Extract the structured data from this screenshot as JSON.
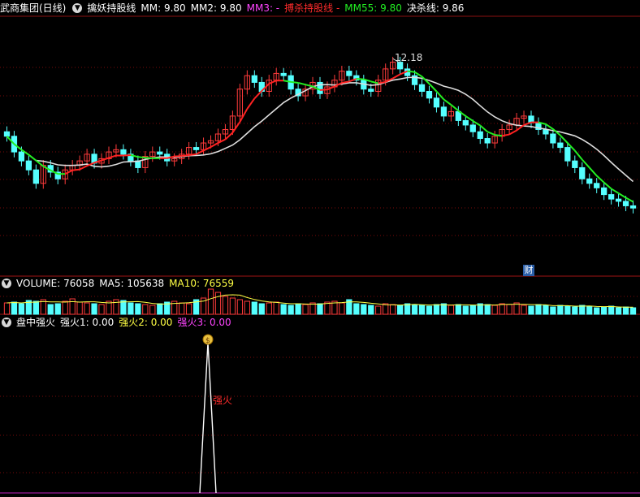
{
  "header": {
    "title": "武商集团(日线)",
    "indicator_name": "擒妖持股线",
    "mm": "MM: 9.80",
    "mm2": "MM2: 9.80",
    "mm3": "MM3: -",
    "bosha": "搏杀持股线  -",
    "mm55": "MM55: 9.80",
    "juesha": "决杀线: 9.86"
  },
  "volume_header": {
    "label": "VOLUME: 76058",
    "ma5": "MA5: 105638",
    "ma10": "MA10: 76559"
  },
  "signal_header": {
    "label": "盘中强火",
    "q1": "强火1: 0.00",
    "q2": "强火2: 0.00",
    "q3": "强火3: 0.00"
  },
  "annotations": {
    "high_label": "12.18",
    "signal_label": "强火",
    "finance_tag": "财"
  },
  "colors": {
    "up": "#ff3b3b",
    "down": "#55ffff",
    "ma_red": "#ff2222",
    "ma_green": "#22ee22",
    "ma_white": "#dddddd",
    "ma_yellow": "#ffff44",
    "grid": "#7a0a0a"
  },
  "chart_data": {
    "type": "candlestick",
    "closes": [
      10.45,
      10.1,
      9.9,
      9.7,
      9.4,
      9.8,
      9.65,
      9.5,
      9.7,
      9.8,
      9.9,
      10.05,
      9.85,
      9.95,
      10.1,
      10.15,
      10.05,
      9.9,
      9.75,
      10.0,
      10.1,
      10.05,
      9.9,
      9.95,
      10.05,
      10.2,
      10.15,
      10.3,
      10.35,
      10.5,
      10.6,
      10.9,
      11.5,
      11.8,
      11.65,
      11.45,
      11.7,
      11.85,
      11.8,
      11.5,
      11.35,
      11.5,
      11.65,
      11.4,
      11.55,
      11.7,
      11.9,
      11.8,
      11.7,
      11.5,
      11.45,
      11.7,
      11.95,
      12.1,
      11.95,
      11.8,
      11.6,
      11.45,
      11.3,
      11.1,
      10.9,
      11.0,
      10.8,
      10.7,
      10.55,
      10.4,
      10.3,
      10.45,
      10.6,
      10.7,
      10.85,
      10.9,
      10.75,
      10.6,
      10.5,
      10.3,
      10.2,
      9.9,
      9.75,
      9.5,
      9.4,
      9.3,
      9.15,
      9.05,
      9.0,
      8.9,
      8.85
    ],
    "ma_lines": [
      "MM",
      "MM2",
      "MM55",
      "决杀线"
    ],
    "volume": [
      1.4,
      1.5,
      1.3,
      1.7,
      1.6,
      1.8,
      1.2,
      1.3,
      1.6,
      1.9,
      1.5,
      1.4,
      1.3,
      1.2,
      1.6,
      1.8,
      1.7,
      1.4,
      1.3,
      1.2,
      1.1,
      1.3,
      1.5,
      1.6,
      1.4,
      1.3,
      1.8,
      2.0,
      3.1,
      2.7,
      2.2,
      2.0,
      1.8,
      1.6,
      1.5,
      1.3,
      1.4,
      1.5,
      1.2,
      1.1,
      1.3,
      1.2,
      1.4,
      1.3,
      1.5,
      1.6,
      1.4,
      1.8,
      1.3,
      1.2,
      1.1,
      1.0,
      1.3,
      1.2,
      1.1,
      1.3,
      1.2,
      1.1,
      1.0,
      1.2,
      1.3,
      1.1,
      1.2,
      1.0,
      1.1,
      1.3,
      1.2,
      1.1,
      1.3,
      1.2,
      1.4,
      1.1,
      1.0,
      1.2,
      1.1,
      0.9,
      1.1,
      1.0,
      0.9,
      1.1,
      1.0,
      0.8,
      0.9,
      1.0,
      0.8,
      0.9,
      0.8
    ],
    "signal_spike_index": 31,
    "high_value": 12.18
  }
}
